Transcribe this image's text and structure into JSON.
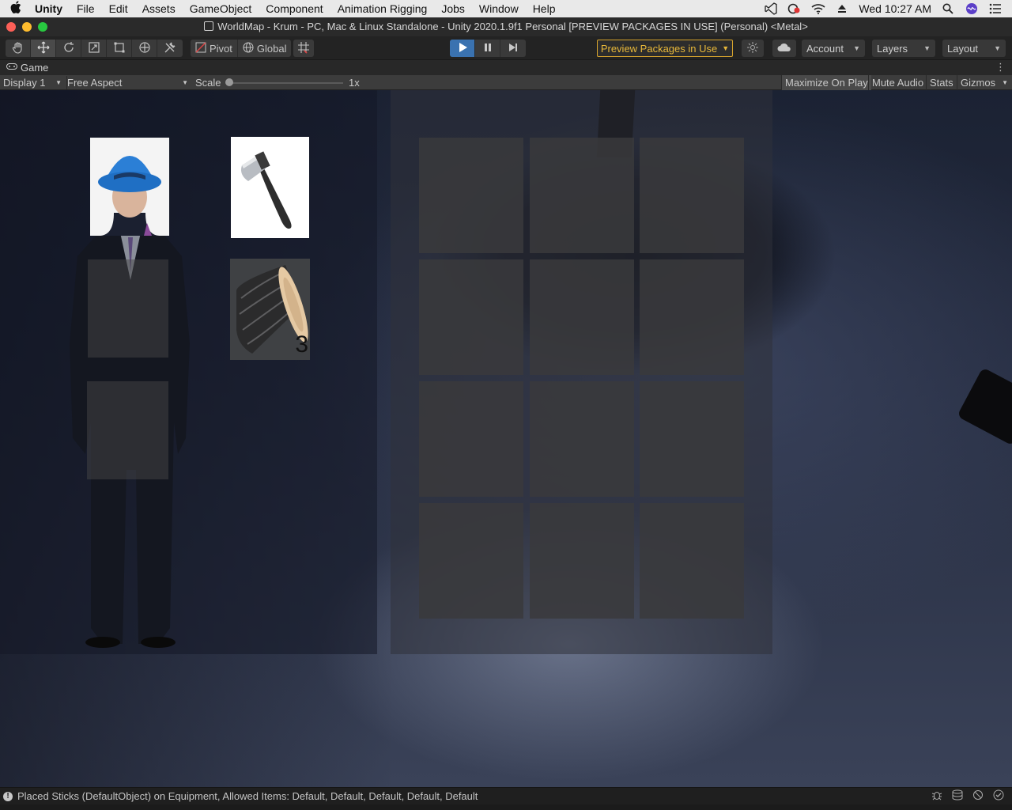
{
  "menubar": {
    "app_name": "Unity",
    "items": [
      "File",
      "Edit",
      "Assets",
      "GameObject",
      "Component",
      "Animation Rigging",
      "Jobs",
      "Window",
      "Help"
    ],
    "clock": "Wed 10:27 AM"
  },
  "window": {
    "title": "WorldMap - Krum - PC, Mac & Linux Standalone - Unity 2020.1.9f1 Personal [PREVIEW PACKAGES IN USE] (Personal) <Metal>"
  },
  "toolbar": {
    "pivot_label": "Pivot",
    "global_label": "Global",
    "preview_packages_label": "Preview Packages in Use",
    "account_label": "Account",
    "layers_label": "Layers",
    "layout_label": "Layout"
  },
  "game_tab": {
    "label": "Game"
  },
  "game_toolbar": {
    "display_label": "Display 1",
    "aspect_label": "Free Aspect",
    "scale_label": "Scale",
    "scale_value": "1x",
    "maximize_label": "Maximize On Play",
    "mute_label": "Mute Audio",
    "stats_label": "Stats",
    "gizmos_label": "Gizmos"
  },
  "equipment": {
    "items": [
      {
        "name": "Bucket Hat",
        "icon": "bucket-hat-icon"
      },
      {
        "name": "Axe",
        "icon": "axe-icon"
      },
      {
        "name": "Log",
        "icon": "log-icon",
        "count": "3"
      }
    ]
  },
  "inventory": {
    "rows": 4,
    "cols": 3
  },
  "status": {
    "message": "Placed Sticks (DefaultObject) on Equipment, Allowed Items: Default, Default, Default, Default, Default"
  },
  "colors": {
    "accent_play": "#3a72b0",
    "preview_warning": "#e8b83a"
  }
}
